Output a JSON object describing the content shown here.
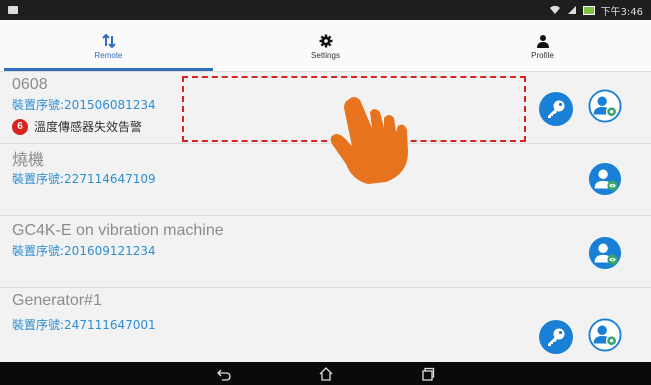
{
  "status_bar": {
    "time": "下午3:46",
    "icons": [
      "notification-icon",
      "wifi-icon",
      "signal-icon",
      "battery-icon"
    ]
  },
  "tabs": [
    {
      "label": "Remote",
      "icon": "sort-arrows-icon",
      "active": true
    },
    {
      "label": "Settings",
      "icon": "gear-icon",
      "active": false
    },
    {
      "label": "Profile",
      "icon": "person-icon",
      "active": false
    }
  ],
  "devices": [
    {
      "name": "0608",
      "serial": "裝置序號:201506081234",
      "alert_count": "6",
      "alert_text": "溫度傳感器失效告警",
      "has_key": true,
      "user_icon": "user-settings"
    },
    {
      "name": "燒機",
      "serial": "裝置序號:227114647109",
      "has_key": false,
      "user_icon": "user-view"
    },
    {
      "name": "GC4K-E on vibration machine",
      "serial": "裝置序號:201609121234",
      "has_key": false,
      "user_icon": "user-view"
    },
    {
      "name": "Generator#1",
      "serial": "裝置序號:247111647001",
      "has_key": true,
      "user_icon": "user-settings"
    }
  ],
  "nav_bar": [
    "back-icon",
    "home-icon",
    "recents-icon"
  ],
  "colors": {
    "accent": "#2f6fbd",
    "serial": "#2d8fd2",
    "alert": "#d9231f",
    "hand": "#e8731f"
  }
}
